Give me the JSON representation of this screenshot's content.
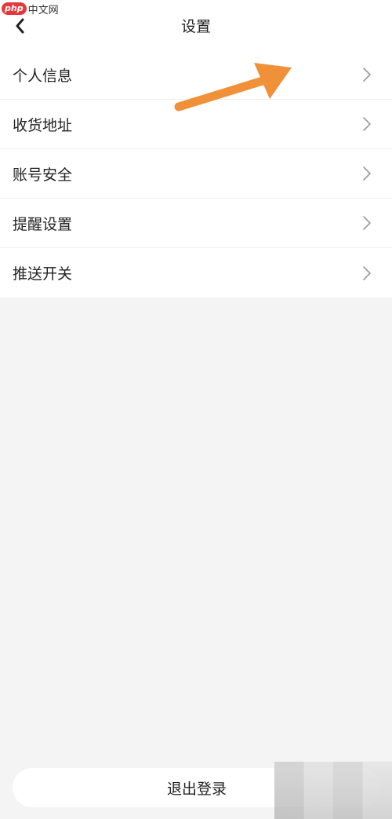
{
  "watermark": {
    "badge": "php",
    "text": "中文网"
  },
  "header": {
    "title": "设置"
  },
  "menu": {
    "items": [
      {
        "label": "个人信息"
      },
      {
        "label": "收货地址"
      },
      {
        "label": "账号安全"
      },
      {
        "label": "提醒设置"
      },
      {
        "label": "推送开关"
      }
    ]
  },
  "footer": {
    "logout_label": "退出登录"
  },
  "colors": {
    "annotation_arrow": "#f0913a",
    "background": "#f4f4f4",
    "watermark_badge": "#e4393c"
  },
  "icons": {
    "back": "chevron-left-icon",
    "item_chevron": "chevron-right-icon"
  }
}
